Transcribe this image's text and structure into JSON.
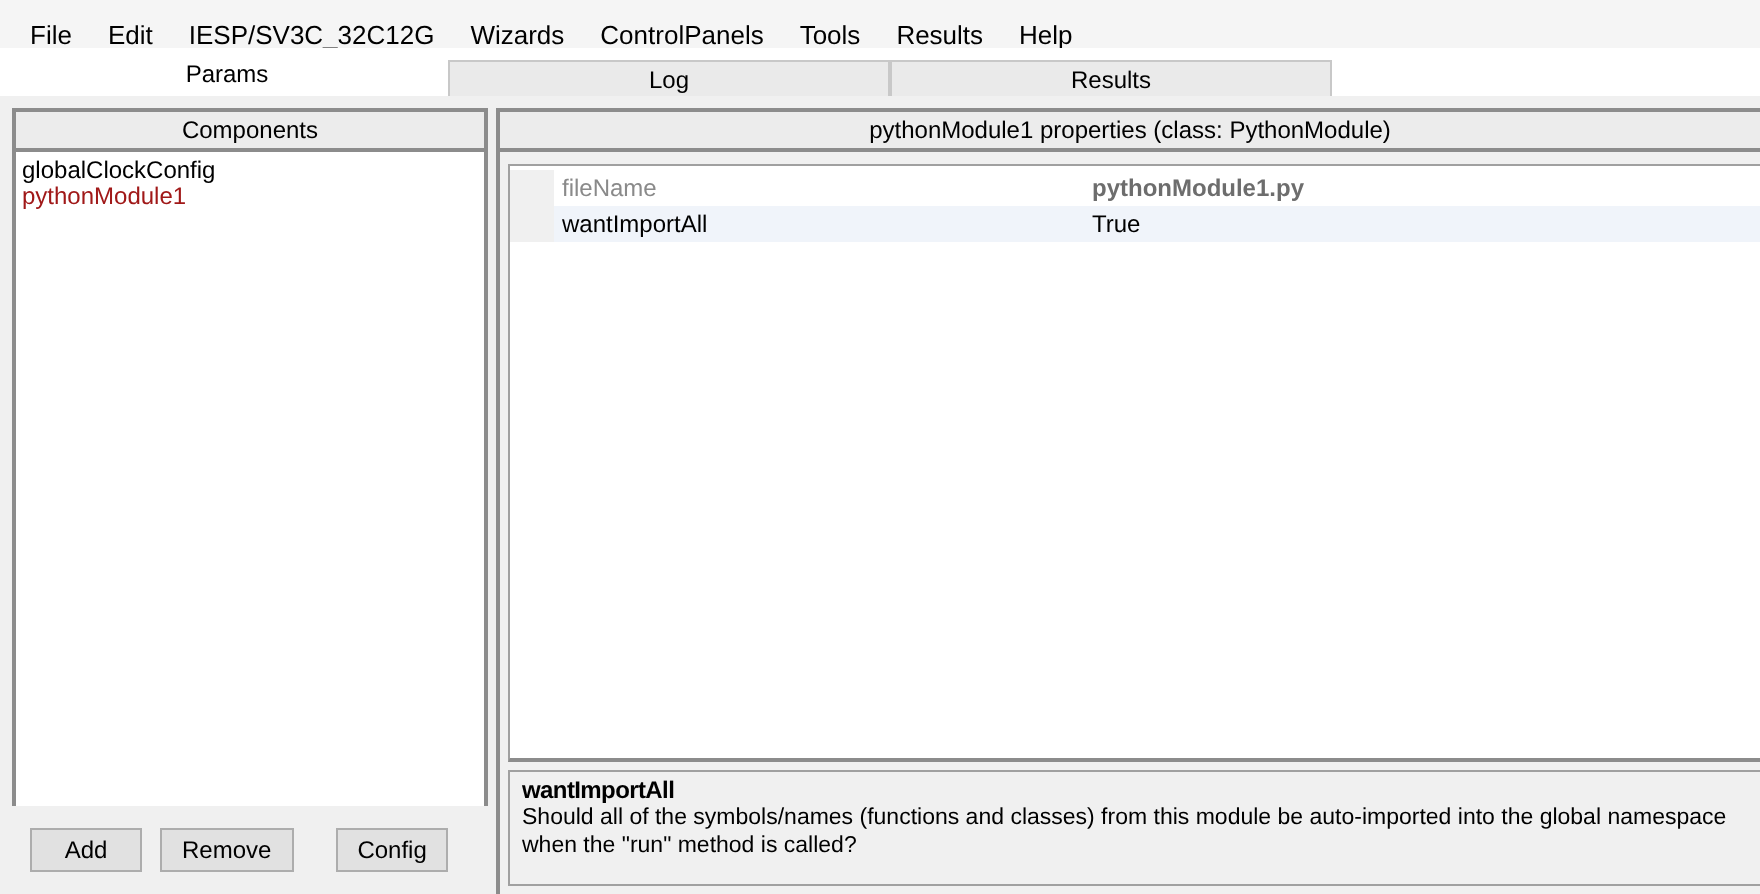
{
  "menu": [
    "File",
    "Edit",
    "IESP/SV3C_32C12G",
    "Wizards",
    "ControlPanels",
    "Tools",
    "Results",
    "Help"
  ],
  "tabs": [
    {
      "label": "Params",
      "selected": true
    },
    {
      "label": "Log",
      "selected": false
    },
    {
      "label": "Results",
      "selected": false
    }
  ],
  "components": {
    "title": "Components",
    "items": [
      {
        "label": "globalClockConfig",
        "selected": false
      },
      {
        "label": "pythonModule1",
        "selected": true
      }
    ],
    "buttons": [
      "Add",
      "Remove",
      "Config"
    ]
  },
  "properties": {
    "title": "pythonModule1 properties (class: PythonModule)",
    "rows": [
      {
        "name": "fileName",
        "value": "pythonModule1.py",
        "disabled": true,
        "selected": false
      },
      {
        "name": "wantImportAll",
        "value": "True",
        "disabled": false,
        "selected": true
      }
    ],
    "description": {
      "title": "wantImportAll",
      "text": "Should all of the symbols/names (functions and classes) from this module be auto-imported into the global namespace when the \"run\" method is called?"
    }
  }
}
